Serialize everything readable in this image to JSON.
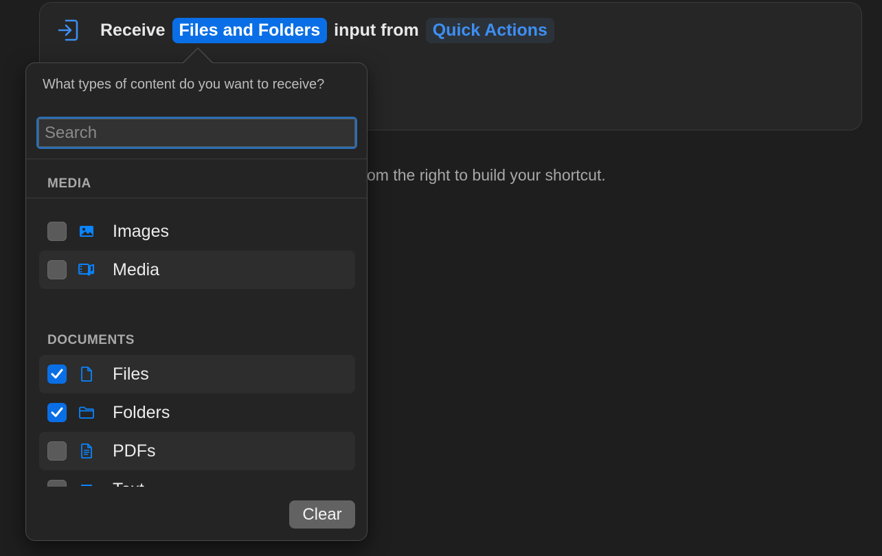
{
  "action": {
    "receive_label": "Receive",
    "input_type_token": "Files and Folders",
    "input_from_label": "input from",
    "source_token": "Quick Actions"
  },
  "hint": "om the right to build your shortcut.",
  "popover": {
    "question": "What types of content do you want to receive?",
    "search_placeholder": "Search",
    "sections": [
      {
        "header": "MEDIA",
        "items": [
          {
            "label": "Images",
            "checked": false,
            "icon": "photo-icon"
          },
          {
            "label": "Media",
            "checked": false,
            "icon": "media-icon"
          }
        ]
      },
      {
        "header": "DOCUMENTS",
        "items": [
          {
            "label": "Files",
            "checked": true,
            "icon": "file-icon"
          },
          {
            "label": "Folders",
            "checked": true,
            "icon": "folder-icon"
          },
          {
            "label": "PDFs",
            "checked": false,
            "icon": "pdf-document-icon"
          },
          {
            "label": "Text",
            "checked": false,
            "icon": "text-icon"
          }
        ]
      }
    ],
    "clear_label": "Clear"
  },
  "colors": {
    "accent": "#0a6fe6",
    "link": "#3d8ff2",
    "background": "#1e1e1e"
  }
}
